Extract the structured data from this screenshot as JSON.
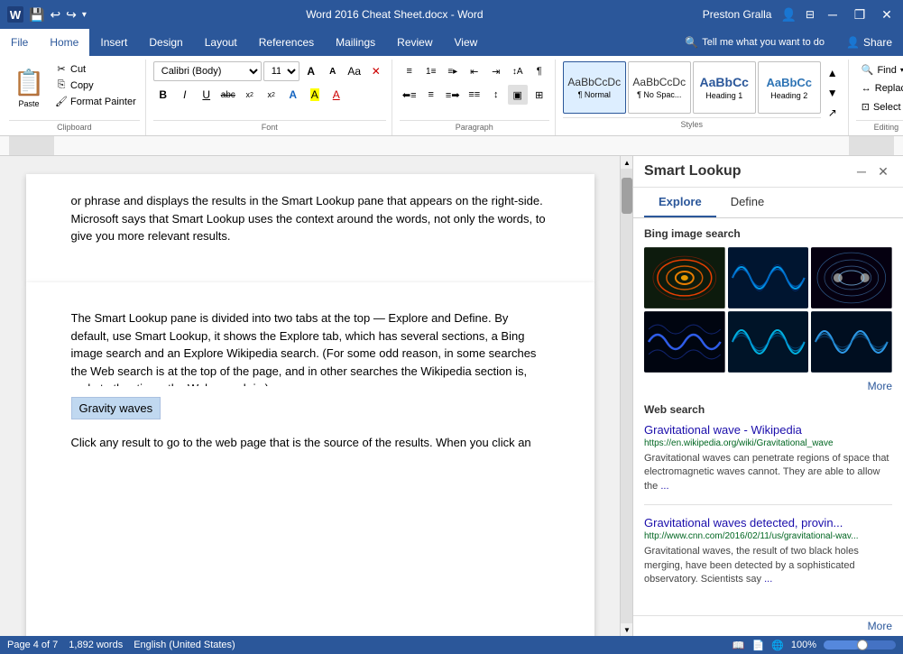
{
  "titlebar": {
    "title": "Word 2016 Cheat Sheet.docx - Word",
    "user": "Preston Gralla",
    "save_icon": "💾",
    "undo_icon": "↩",
    "redo_icon": "↪",
    "customize_icon": "▾",
    "minimize_icon": "─",
    "restore_icon": "❐",
    "close_icon": "✕",
    "profile_icon": "👤"
  },
  "menubar": {
    "items": [
      "File",
      "Home",
      "Insert",
      "Design",
      "Layout",
      "References",
      "Mailings",
      "Review",
      "View"
    ],
    "active": "Home",
    "search_placeholder": "Tell me what you want to do",
    "share_label": "Share"
  },
  "ribbon": {
    "clipboard_group": {
      "label": "Clipboard",
      "paste_label": "Paste",
      "cut_label": "Cut",
      "copy_label": "Copy",
      "format_painter_label": "Format Painter",
      "expand_icon": "↗"
    },
    "font_group": {
      "label": "Font",
      "font_name": "Calibri (Body)",
      "font_size": "11",
      "grow_icon": "A",
      "shrink_icon": "A",
      "change_case_icon": "Aa",
      "clear_format_icon": "✕",
      "bold": "B",
      "italic": "I",
      "underline": "U",
      "strikethrough": "abc",
      "subscript": "x₂",
      "superscript": "x²",
      "text_effects": "A",
      "text_highlight": "A",
      "font_color": "A",
      "expand_icon": "↗"
    },
    "paragraph_group": {
      "label": "Paragraph",
      "bullets_icon": "≡",
      "numbering_icon": "≡#",
      "multilevel_icon": "≡▶",
      "decrease_indent": "←",
      "increase_indent": "→",
      "sort_icon": "↕A",
      "show_hide_icon": "¶",
      "align_left": "≡",
      "align_center": "≡",
      "align_right": "≡",
      "justify": "≡",
      "line_spacing": "↕",
      "shading": "▣",
      "borders": "⊞",
      "expand_icon": "↗"
    },
    "styles_group": {
      "label": "Styles",
      "items": [
        {
          "label": "¶ Normal",
          "preview": "AaBbCcDc",
          "id": "normal",
          "active": true
        },
        {
          "label": "¶ No Spac...",
          "preview": "AaBbCcDc",
          "id": "no-space"
        },
        {
          "label": "Heading 1",
          "preview": "AaBbCc",
          "id": "heading1"
        },
        {
          "label": "Heading 2",
          "preview": "AaBbCc",
          "id": "heading2"
        }
      ],
      "scroll_down_icon": "▾",
      "expand_icon": "↗"
    },
    "editing_group": {
      "label": "Editing",
      "find_label": "Find",
      "find_icon": "🔍",
      "replace_label": "Replace",
      "replace_icon": "↔",
      "select_label": "Select ▾",
      "select_icon": "⊡"
    }
  },
  "ribbon_labels": [
    {
      "label": "Clipboard",
      "has_expand": true
    },
    {
      "label": "Font",
      "has_expand": true
    },
    {
      "label": "Paragraph",
      "has_expand": true
    },
    {
      "label": "Styles",
      "has_expand": true
    },
    {
      "label": "Editing",
      "has_expand": false
    }
  ],
  "document": {
    "text1": "or phrase and displays the results in the Smart Lookup pane that appears on the right-side. Microsoft says that Smart Lookup uses the context around the words, not only the words, to give you more relevant results.",
    "text2": "The Smart Lookup pane is divided into two tabs at the top — Explore and Define. By default, use Smart Lookup, it shows the Explore tab, which has several sections, a Bing image search and an Explore Wikipedia search. (For some odd reason, in some searches the Web search is at the top of the page, and in other searches the Wikipedia section is, and at other times the Web search is.)",
    "highlighted_text": "Gravity waves",
    "text3": "Click any result to go to the web page that is the source of the results. When you click an"
  },
  "smart_lookup": {
    "title": "Smart Lookup",
    "close_icon": "✕",
    "collapse_icon": "─",
    "tabs": [
      "Explore",
      "Define"
    ],
    "active_tab": "Explore",
    "bing_section_title": "Bing image search",
    "more_label": "More",
    "web_section_title": "Web search",
    "results": [
      {
        "title": "Gravitational wave - Wikipedia",
        "url": "https://en.wikipedia.org/wiki/Gravitational_wave",
        "snippet": "Gravitational waves can penetrate regions of space that electromagnetic waves cannot. They are able to allow the",
        "has_ellipsis": true
      },
      {
        "title": "Gravitational waves detected, provin...",
        "url": "http://www.cnn.com/2016/02/11/us/gravitational-wav...",
        "snippet": "Gravitational waves, the result of two black holes merging, have been detected by a sophisticated observatory. Scientists say",
        "has_ellipsis": true
      }
    ]
  },
  "statusbar": {
    "page_info": "Page 4 of 7",
    "word_count": "1,892 words",
    "language": "English (United States)",
    "zoom": "100%"
  },
  "icons": {
    "save": "💾",
    "undo": "↩",
    "redo": "↪",
    "search": "🔍",
    "share": "👤"
  }
}
